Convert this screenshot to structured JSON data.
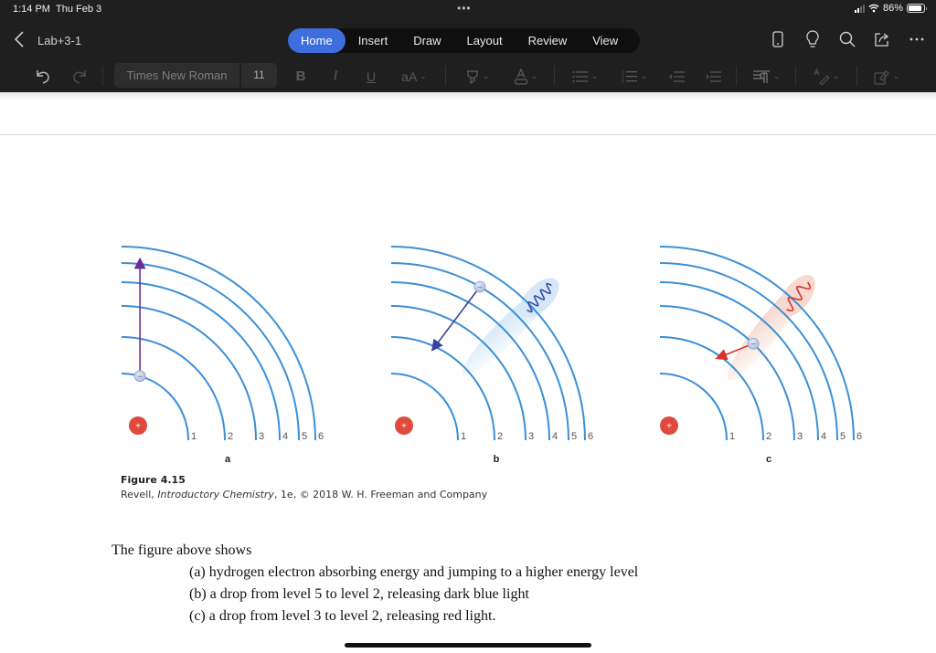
{
  "status_bar": {
    "time": "1:14 PM",
    "date": "Thu Feb 3",
    "battery_percent_label": "86%",
    "battery_level": 0.86,
    "icons": [
      "signal-icon",
      "wifi-icon",
      "battery-icon"
    ]
  },
  "title_bar": {
    "back_icon": "chevron-left-icon",
    "document_name": "Lab+3-1",
    "tabs": [
      {
        "label": "Home",
        "active": true
      },
      {
        "label": "Insert",
        "active": false
      },
      {
        "label": "Draw",
        "active": false
      },
      {
        "label": "Layout",
        "active": false
      },
      {
        "label": "Review",
        "active": false
      },
      {
        "label": "View",
        "active": false
      }
    ],
    "right_icons": [
      "phone-view-icon",
      "lightbulb-icon",
      "search-icon",
      "share-icon",
      "more-icon"
    ]
  },
  "toolbar": {
    "undo_icon": "undo-icon",
    "redo_icon": "redo-icon",
    "font_name": "Times New Roman",
    "font_size": "11",
    "bold": "B",
    "italic": "I",
    "underline": "U",
    "font_case": "aA",
    "icons": [
      "highlighter-icon",
      "font-color-icon",
      "bullet-list-icon",
      "numbered-list-icon",
      "decrease-indent-icon",
      "increase-indent-icon",
      "paragraph-icon",
      "styles-icon",
      "clear-format-icon"
    ]
  },
  "figure": {
    "panels": [
      {
        "label": "a",
        "transition": "absorb 1 to 5",
        "orbit_labels": [
          "1",
          "2",
          "3",
          "4",
          "5",
          "6"
        ],
        "nucleus_symbol": "+",
        "electron_symbol": "−",
        "arrow_color": "#6a2c9a"
      },
      {
        "label": "b",
        "transition": "emit 5 to 2",
        "orbit_labels": [
          "1",
          "2",
          "3",
          "4",
          "5",
          "6"
        ],
        "nucleus_symbol": "+",
        "electron_symbol": "−",
        "arrow_color": "#3a3fa0",
        "photon_color": "#3a4bb0",
        "glow_color": "#d6e8f8"
      },
      {
        "label": "c",
        "transition": "emit 3 to 2",
        "orbit_labels": [
          "1",
          "2",
          "3",
          "4",
          "5",
          "6"
        ],
        "nucleus_symbol": "+",
        "electron_symbol": "−",
        "arrow_color": "#d8322a",
        "photon_color": "#d8322a",
        "glow_color": "#f7d9cf"
      }
    ],
    "orbit_color": "#3b8fd6",
    "nucleus_color": "#e04a3c",
    "caption_title": "Figure 4.15",
    "caption_author": "Revell, ",
    "caption_book": "Introductory Chemistry",
    "caption_rest": ", 1e, © 2018 W. H. Freeman and Company"
  },
  "body": {
    "intro": "The figure above shows",
    "items": [
      "(a) hydrogen electron absorbing energy and jumping to a higher energy level",
      "(b) a drop from level 5 to level 2, releasing dark blue light",
      "(c) a drop from level 3 to level 2, releasing red light."
    ]
  }
}
